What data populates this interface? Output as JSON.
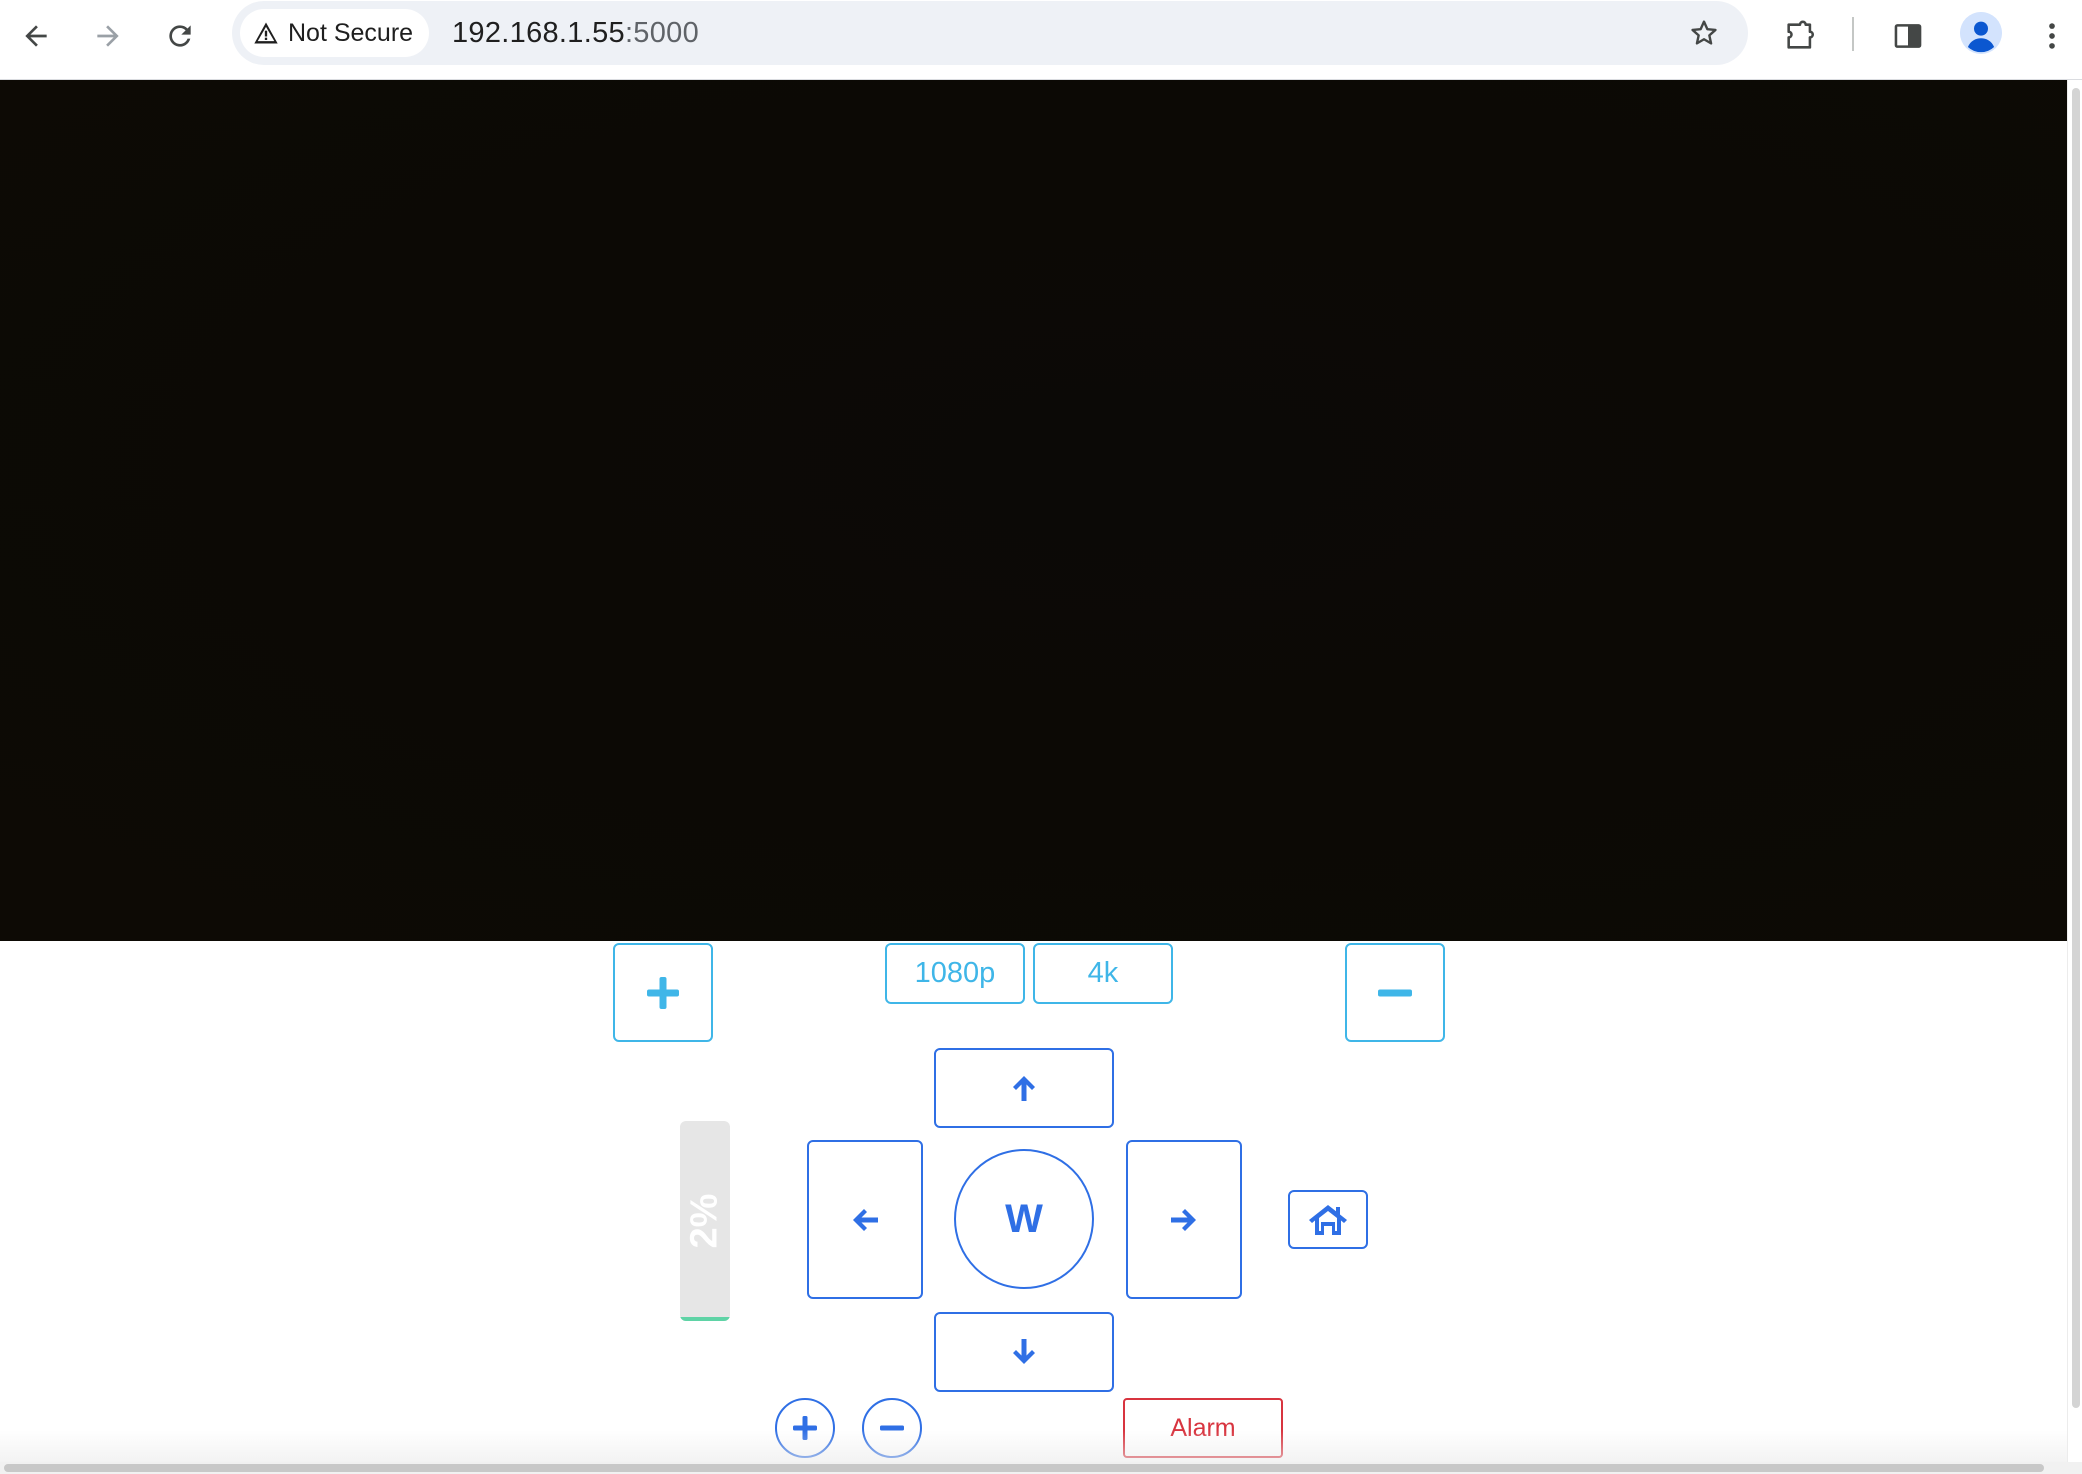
{
  "browser": {
    "security_label": "Not Secure",
    "url_host": "192.168.1.55",
    "url_port": ":5000",
    "icons": [
      "back-arrow-icon",
      "forward-arrow-icon",
      "reload-icon",
      "warning-triangle-icon",
      "star-icon",
      "extensions-puzzle-icon",
      "side-panel-icon",
      "profile-avatar-icon",
      "more-vert-icon"
    ]
  },
  "stream": {
    "state": "dark video feed"
  },
  "controls": {
    "res_1080": "1080p",
    "res_4k": "4k",
    "center_label": "W",
    "zoom_level_text": "2%",
    "zoom_level_fraction": 0.02,
    "alarm_label": "Alarm",
    "icons": [
      "plus-icon",
      "minus-icon",
      "arrow-up-icon",
      "arrow-left-icon",
      "arrow-right-icon",
      "arrow-down-icon",
      "home-icon",
      "plus-circle-icon",
      "minus-circle-icon"
    ]
  },
  "colors": {
    "accent_blue": "#2f6fe5",
    "accent_cyan": "#3fb6e8",
    "alarm_red": "#d8343f",
    "zoom_fill": "#5fd3a6",
    "video_bg": "#0c0905"
  }
}
